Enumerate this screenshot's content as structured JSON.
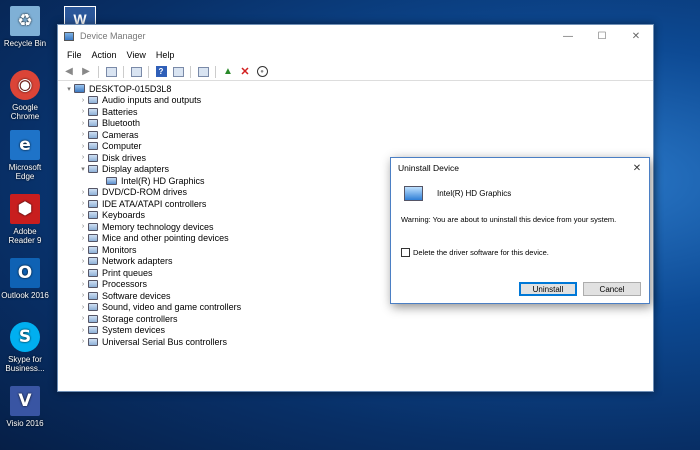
{
  "desktop": {
    "icons": [
      {
        "label": "Recycle Bin",
        "icon": "recycle-bin-icon",
        "color": "#7fb0d6"
      },
      {
        "label": "Google Chrome",
        "icon": "chrome-icon",
        "color": "#db4437"
      },
      {
        "label": "Microsoft Edge",
        "icon": "edge-icon",
        "color": "#1e73c8"
      },
      {
        "label": "Adobe Reader 9",
        "icon": "adobe-reader-icon",
        "color": "#c81e1e"
      },
      {
        "label": "Outlook 2016",
        "icon": "outlook-icon",
        "color": "#0f62b4"
      },
      {
        "label": "Skype for Business...",
        "icon": "skype-icon",
        "color": "#00aff0"
      },
      {
        "label": "Visio 2016",
        "icon": "visio-icon",
        "color": "#3955a3"
      }
    ],
    "word_icon": "W"
  },
  "window": {
    "title": "Device Manager",
    "minimize": "—",
    "maximize": "☐",
    "close": "✕"
  },
  "menu": [
    "File",
    "Action",
    "View",
    "Help"
  ],
  "tree": {
    "root": "DESKTOP-015D3L8",
    "items": [
      {
        "label": "Audio inputs and outputs",
        "expanded": false
      },
      {
        "label": "Batteries",
        "expanded": false
      },
      {
        "label": "Bluetooth",
        "expanded": false
      },
      {
        "label": "Cameras",
        "expanded": false
      },
      {
        "label": "Computer",
        "expanded": false
      },
      {
        "label": "Disk drives",
        "expanded": false
      },
      {
        "label": "Display adapters",
        "expanded": true,
        "child": "Intel(R) HD Graphics"
      },
      {
        "label": "DVD/CD-ROM drives",
        "expanded": false
      },
      {
        "label": "IDE ATA/ATAPI controllers",
        "expanded": false
      },
      {
        "label": "Keyboards",
        "expanded": false
      },
      {
        "label": "Memory technology devices",
        "expanded": false
      },
      {
        "label": "Mice and other pointing devices",
        "expanded": false
      },
      {
        "label": "Monitors",
        "expanded": false
      },
      {
        "label": "Network adapters",
        "expanded": false
      },
      {
        "label": "Print queues",
        "expanded": false
      },
      {
        "label": "Processors",
        "expanded": false
      },
      {
        "label": "Software devices",
        "expanded": false
      },
      {
        "label": "Sound, video and game controllers",
        "expanded": false
      },
      {
        "label": "Storage controllers",
        "expanded": false
      },
      {
        "label": "System devices",
        "expanded": false
      },
      {
        "label": "Universal Serial Bus controllers",
        "expanded": false
      }
    ]
  },
  "dialog": {
    "title": "Uninstall Device",
    "close": "✕",
    "device_name": "Intel(R) HD Graphics",
    "warning": "Warning: You are about to uninstall this device from your system.",
    "checkbox_label": "Delete the driver software for this device.",
    "checkbox_checked": false,
    "uninstall_label": "Uninstall",
    "cancel_label": "Cancel"
  },
  "colors": {
    "accent": "#0078d7",
    "desktop_bg": "#0d4a94"
  }
}
